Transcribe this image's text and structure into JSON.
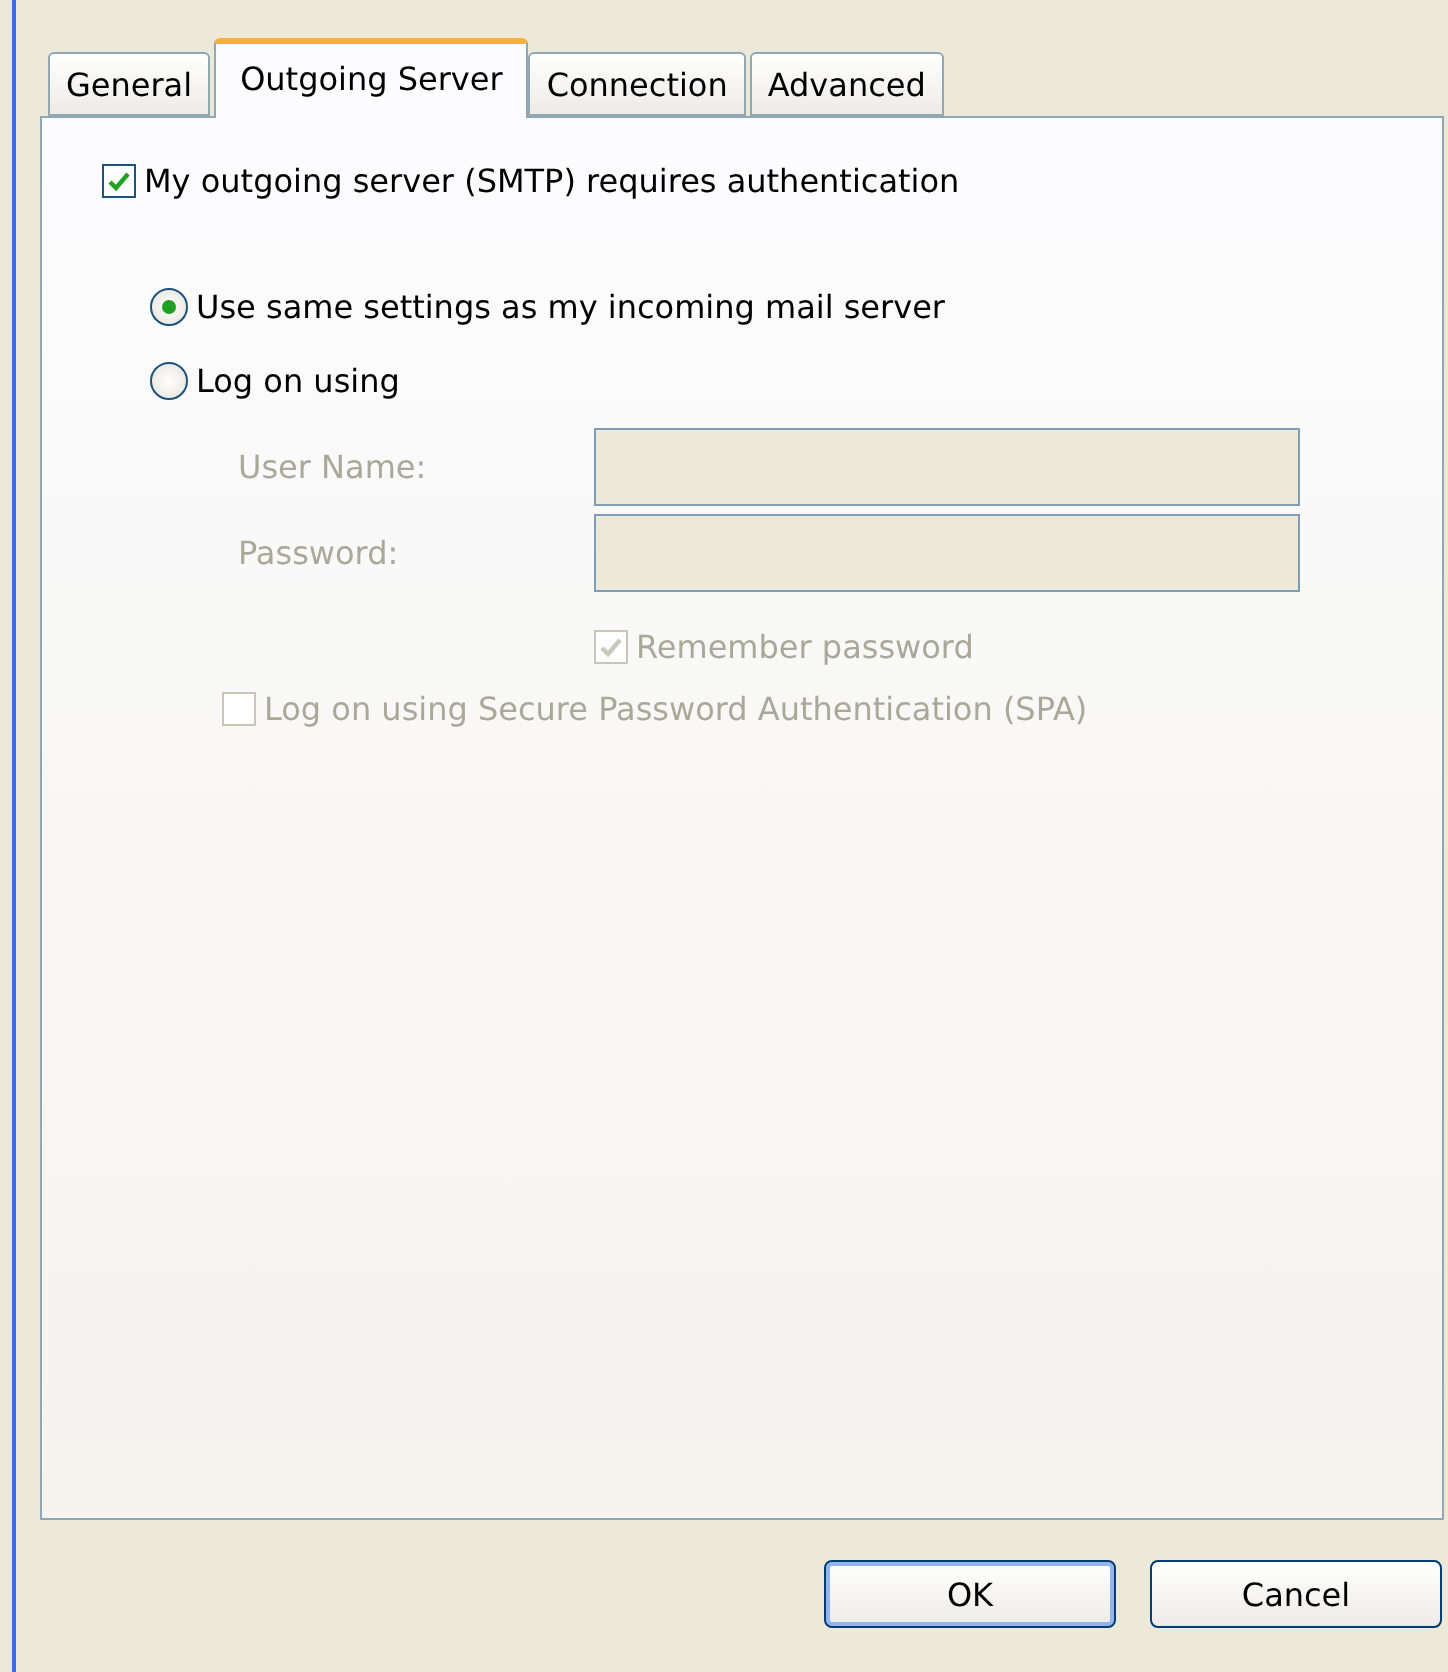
{
  "tabs": [
    {
      "label": "General",
      "selected": false
    },
    {
      "label": "Outgoing Server",
      "selected": true
    },
    {
      "label": "Connection",
      "selected": false
    },
    {
      "label": "Advanced",
      "selected": false
    }
  ],
  "auth_checkbox": {
    "label": "My outgoing server (SMTP) requires authentication",
    "checked": true
  },
  "radios": [
    {
      "label": "Use same settings as my incoming mail server",
      "selected": true
    },
    {
      "label": "Log on using",
      "selected": false
    }
  ],
  "fields": [
    {
      "label": "User Name:",
      "disabled": true
    },
    {
      "label": "Password:",
      "disabled": true
    }
  ],
  "remember_checkbox": {
    "label": "Remember password",
    "checked": true,
    "disabled": true
  },
  "spa_checkbox": {
    "label": "Log on using Secure Password Authentication (SPA)",
    "checked": false,
    "disabled": true
  },
  "buttons": [
    {
      "label": "OK",
      "kind": "default"
    },
    {
      "label": "Cancel",
      "kind": "normal"
    }
  ]
}
